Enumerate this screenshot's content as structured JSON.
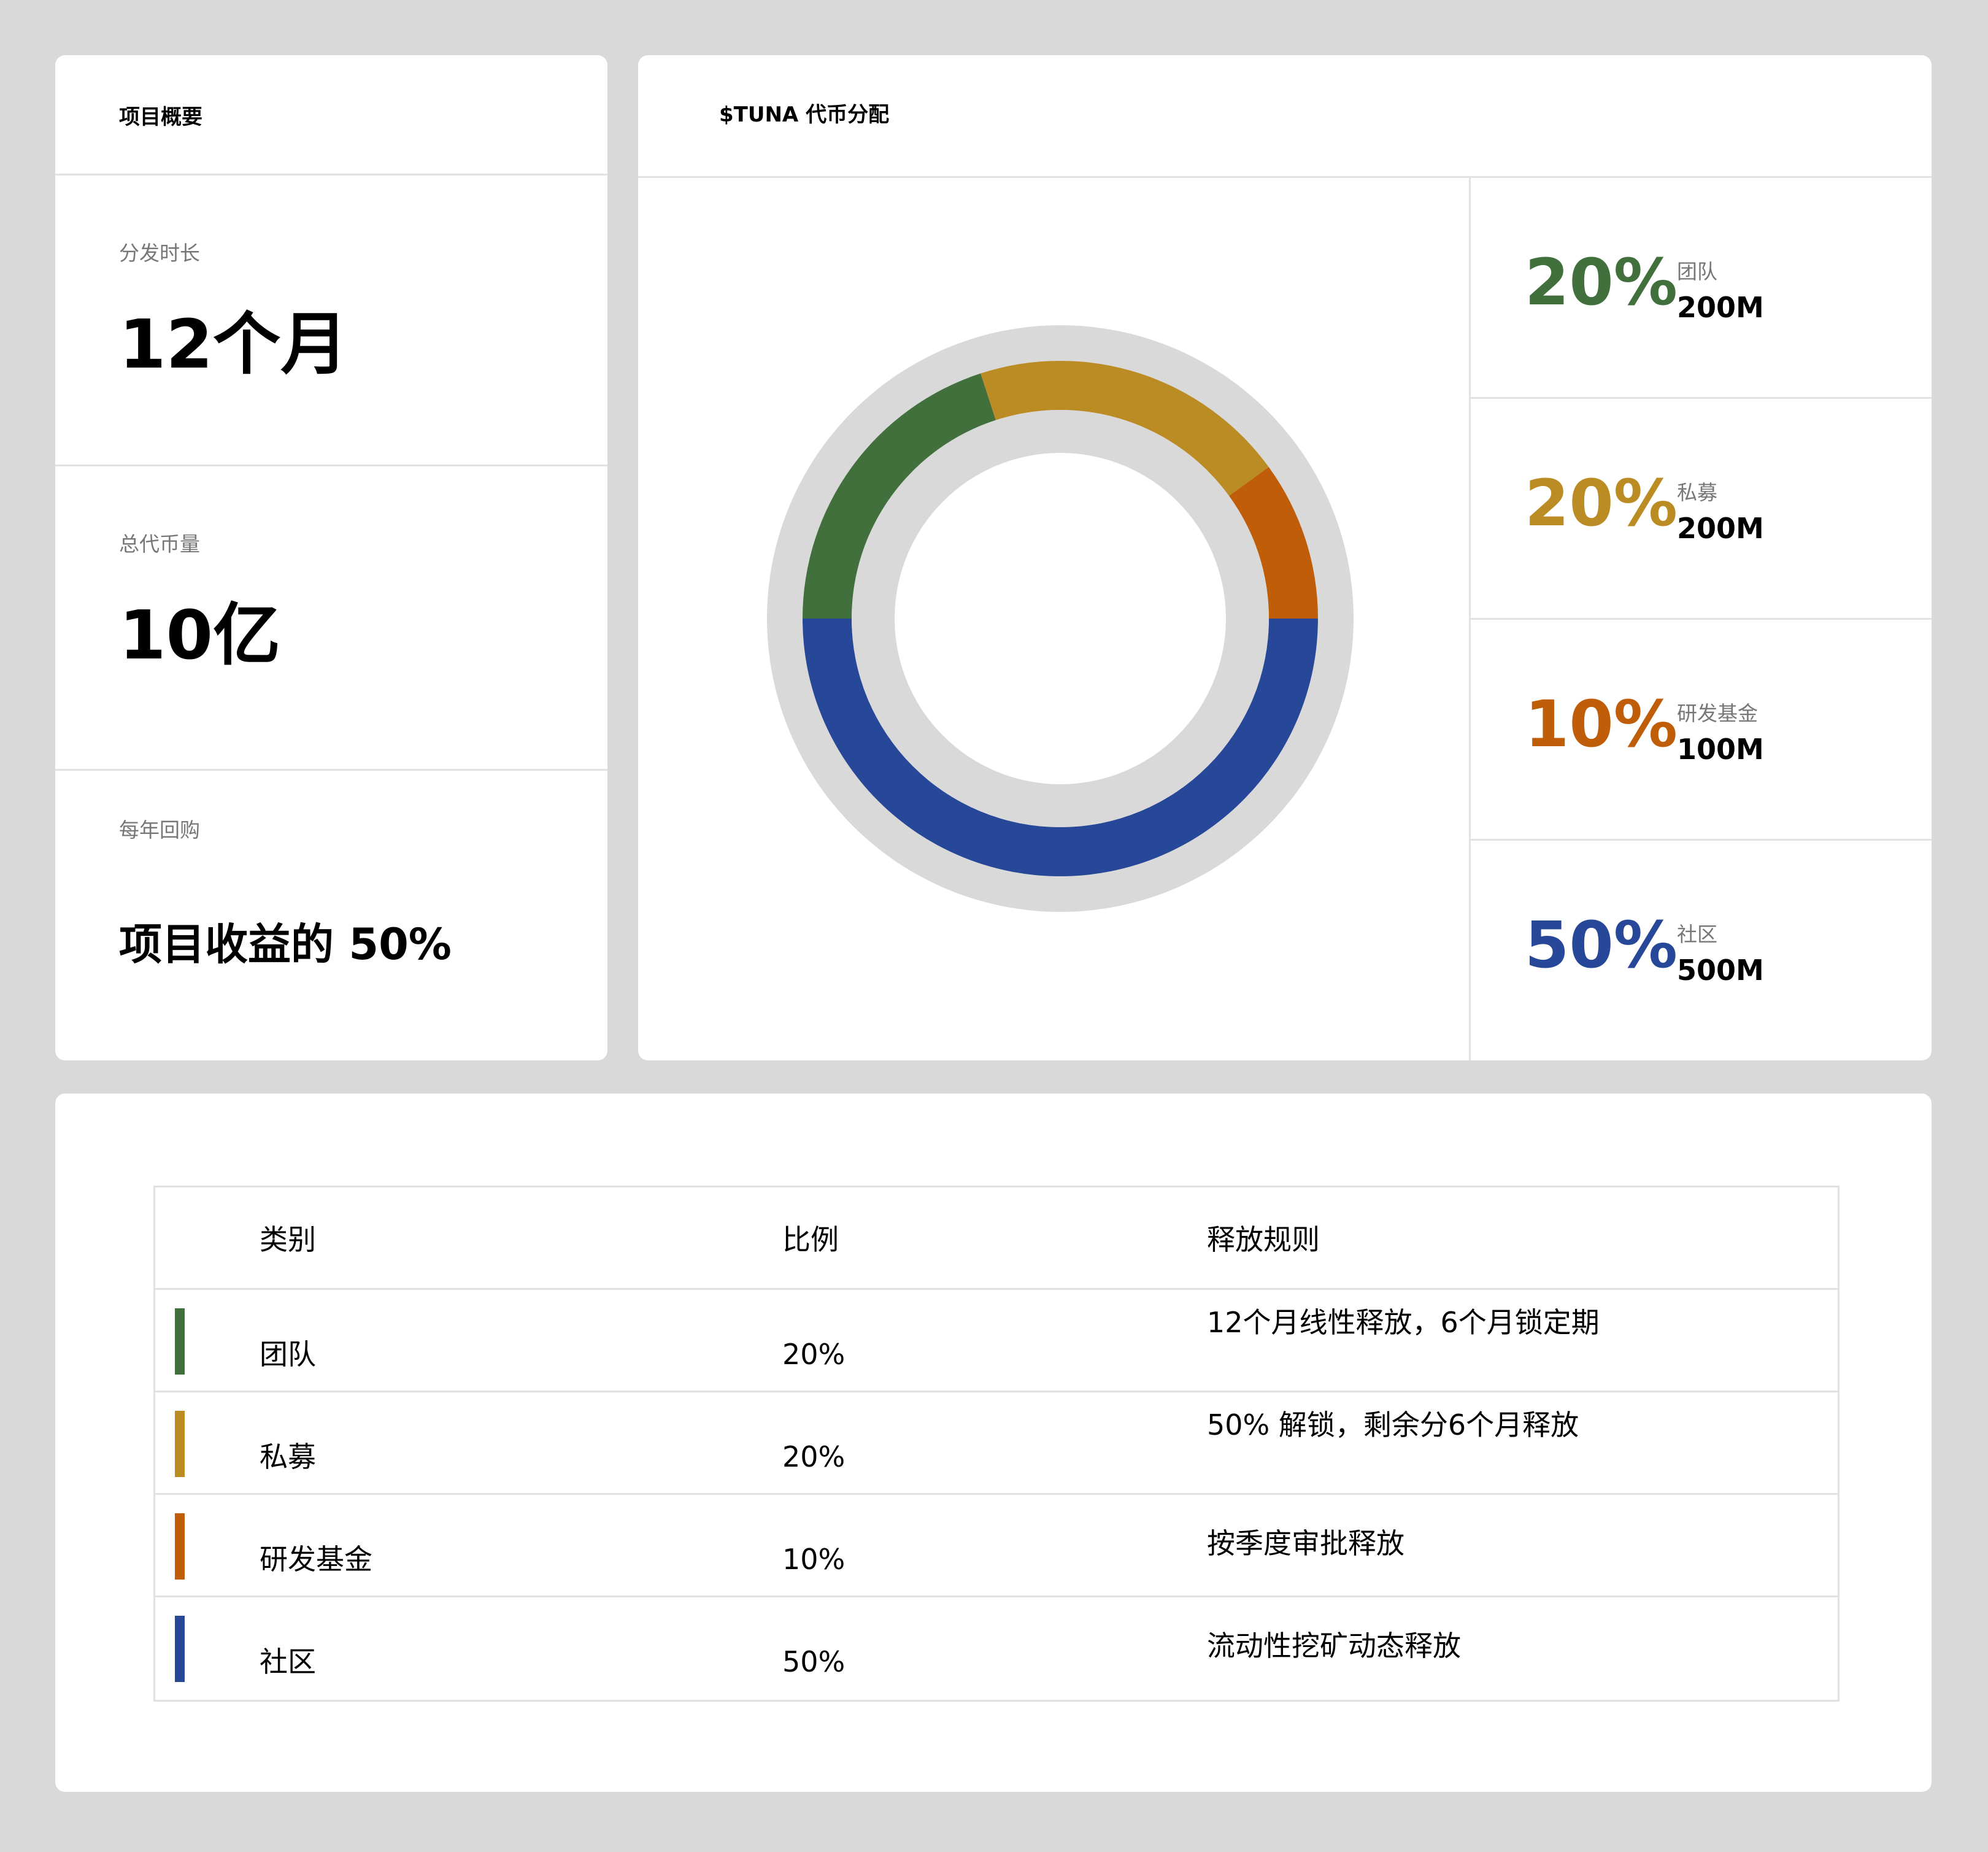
{
  "overview": {
    "title": "项目概要",
    "stats": [
      {
        "label": "分发时长",
        "value": "12个月"
      },
      {
        "label": "总代币量",
        "value": "10亿"
      },
      {
        "label": "每年回购",
        "value": "项目收益的 50%"
      }
    ]
  },
  "allocation": {
    "title": "$TUNA 代币分配",
    "legend": [
      {
        "percent": "20%",
        "name": "团队",
        "amount": "200M",
        "color": "#41703d"
      },
      {
        "percent": "20%",
        "name": "私募",
        "amount": "200M",
        "color": "#bb8c24"
      },
      {
        "percent": "10%",
        "name": "研发基金",
        "amount": "100M",
        "color": "#bf5d08"
      },
      {
        "percent": "50%",
        "name": "社区",
        "amount": "500M",
        "color": "#274898"
      }
    ]
  },
  "chart_data": {
    "type": "pie",
    "title": "$TUNA 代币分配",
    "categories": [
      "团队",
      "私募",
      "研发基金",
      "社区"
    ],
    "values": [
      20,
      20,
      10,
      50
    ],
    "amounts": [
      "200M",
      "200M",
      "100M",
      "500M"
    ],
    "colors": [
      "#41703d",
      "#bb8c24",
      "#bf5d08",
      "#274898"
    ],
    "style": "donut",
    "legend": "right"
  },
  "table": {
    "headers": {
      "category": "类别",
      "ratio": "比例",
      "rule": "释放规则"
    },
    "rows": [
      {
        "category": "团队",
        "ratio": "20%",
        "rule": "12个月线性释放，6个月锁定期",
        "color": "#41703d"
      },
      {
        "category": "私募",
        "ratio": "20%",
        "rule": "50% 解锁，剩余分6个月释放",
        "color": "#bb8c24"
      },
      {
        "category": "研发基金",
        "ratio": "10%",
        "rule": "按季度审批释放",
        "color": "#bf5d08"
      },
      {
        "category": "社区",
        "ratio": "50%",
        "rule": "流动性挖矿动态释放",
        "color": "#274898"
      }
    ]
  }
}
